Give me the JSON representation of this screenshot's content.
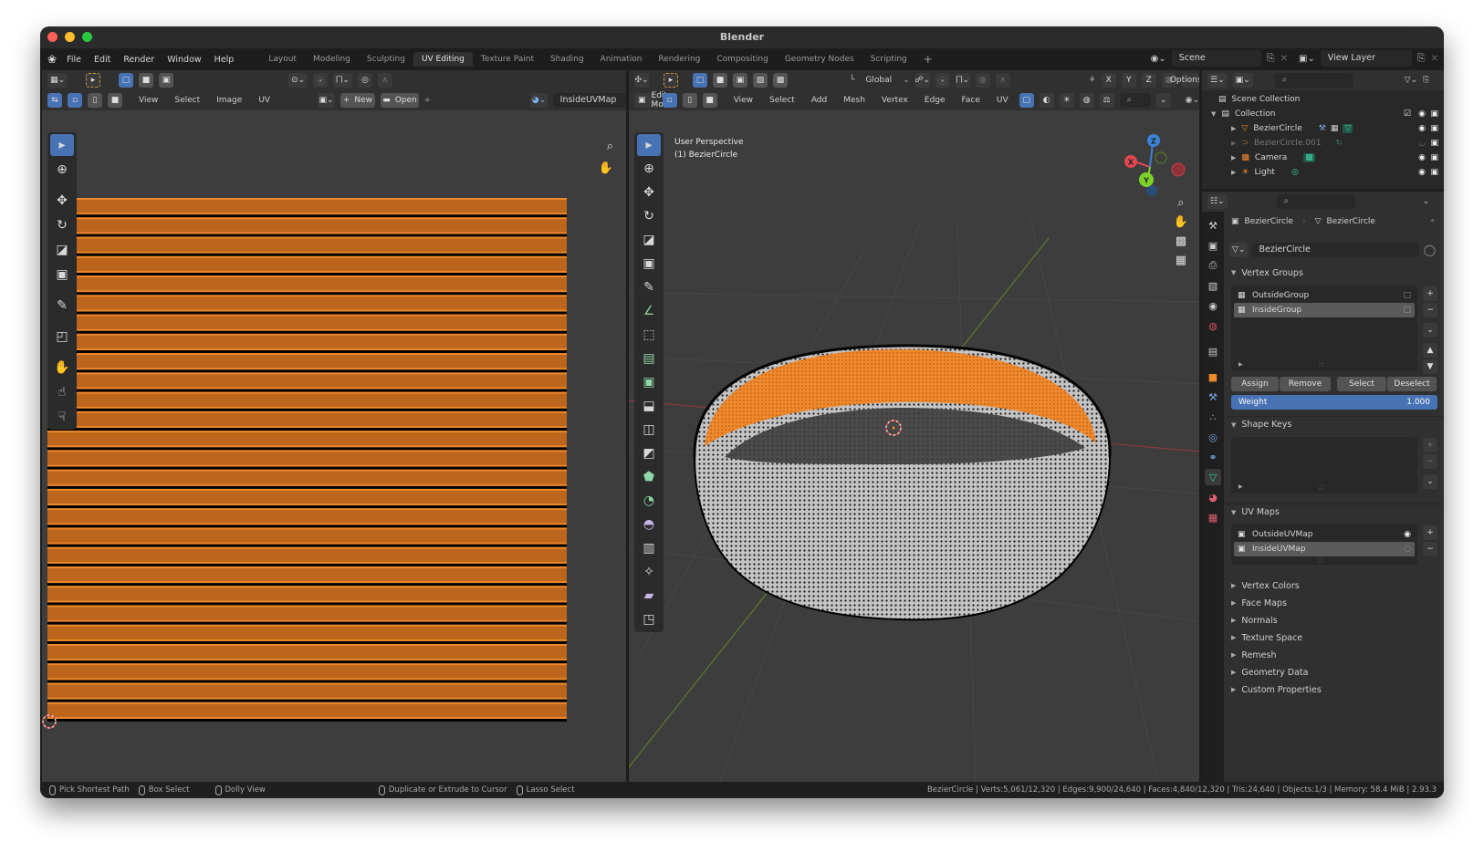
{
  "window": {
    "title": "Blender",
    "traffic_lights": {
      "close": "#ff5f57",
      "minimize": "#febc2e",
      "maximize": "#28c840"
    }
  },
  "topbar": {
    "logo_icon": "blender-logo-icon",
    "menus": [
      "File",
      "Edit",
      "Render",
      "Window",
      "Help"
    ],
    "workspaces": [
      "Layout",
      "Modeling",
      "Sculpting",
      "UV Editing",
      "Texture Paint",
      "Shading",
      "Animation",
      "Rendering",
      "Compositing",
      "Geometry Nodes",
      "Scripting"
    ],
    "active_workspace": "UV Editing",
    "add_workspace": "+",
    "scene": "Scene",
    "view_layer": "View Layer"
  },
  "uv_editor": {
    "header_menus": [
      "View",
      "Select",
      "Image",
      "UV"
    ],
    "new_label": "New",
    "open_label": "Open",
    "uv_map": "InsideUVMap",
    "colors": {
      "uv_orange": "#f0882c",
      "uv_edge": "#000000",
      "bg": "#3d3d3d"
    },
    "tools": [
      "select-box",
      "cursor",
      "move",
      "rotate",
      "scale",
      "transform",
      "annotate",
      "rip",
      "grab",
      "relax",
      "pinch"
    ]
  },
  "viewport": {
    "mode": "Edit Mode",
    "orientation": "Global",
    "options": "Options",
    "header_menus": [
      "View",
      "Select",
      "Add",
      "Mesh",
      "Vertex",
      "Edge",
      "Face",
      "UV"
    ],
    "axes": [
      "X",
      "Y",
      "Z"
    ],
    "overlay_text_line1": "User Perspective",
    "overlay_text_line2": "(1) BezierCircle",
    "gizmo": {
      "x": "X",
      "y": "Y",
      "z": "Z",
      "x_color": "#e0474f",
      "y_color": "#7dd22a",
      "z_color": "#3b82d6"
    },
    "colors": {
      "selected": "#f0882c",
      "mesh": "#b8b8b8",
      "bg": "#3d3d3d"
    }
  },
  "outliner": {
    "root": "Scene Collection",
    "collection": "Collection",
    "items": [
      {
        "name": "BezierCircle",
        "dim": false
      },
      {
        "name": "BezierCircle.001",
        "dim": true
      },
      {
        "name": "Camera",
        "dim": false
      },
      {
        "name": "Light",
        "dim": false
      }
    ]
  },
  "properties": {
    "breadcrumb_object": "BezierCircle",
    "breadcrumb_data": "BezierCircle",
    "datablock": "BezierCircle",
    "vertex_groups": {
      "title": "Vertex Groups",
      "items": [
        "OutsideGroup",
        "InsideGroup"
      ],
      "selected": "InsideGroup",
      "buttons": [
        "Assign",
        "Remove",
        "Select",
        "Deselect"
      ],
      "weight_label": "Weight",
      "weight_value": "1.000"
    },
    "shape_keys": {
      "title": "Shape Keys"
    },
    "uv_maps": {
      "title": "UV Maps",
      "items": [
        "OutsideUVMap",
        "InsideUVMap"
      ],
      "selected": "InsideUVMap"
    },
    "collapsed_sections": [
      "Vertex Colors",
      "Face Maps",
      "Normals",
      "Texture Space",
      "Remesh",
      "Geometry Data",
      "Custom Properties"
    ]
  },
  "statusbar": {
    "hints": [
      "Pick Shortest Path",
      "Box Select",
      "Dolly View",
      "Duplicate or Extrude to Cursor",
      "Lasso Select"
    ],
    "stats": "BezierCircle | Verts:5,061/12,320 | Edges:9,900/24,640 | Faces:4,840/12,320 | Tris:24,640 | Objects:1/3 | Memory: 58.4 MiB | 2.93.3"
  }
}
